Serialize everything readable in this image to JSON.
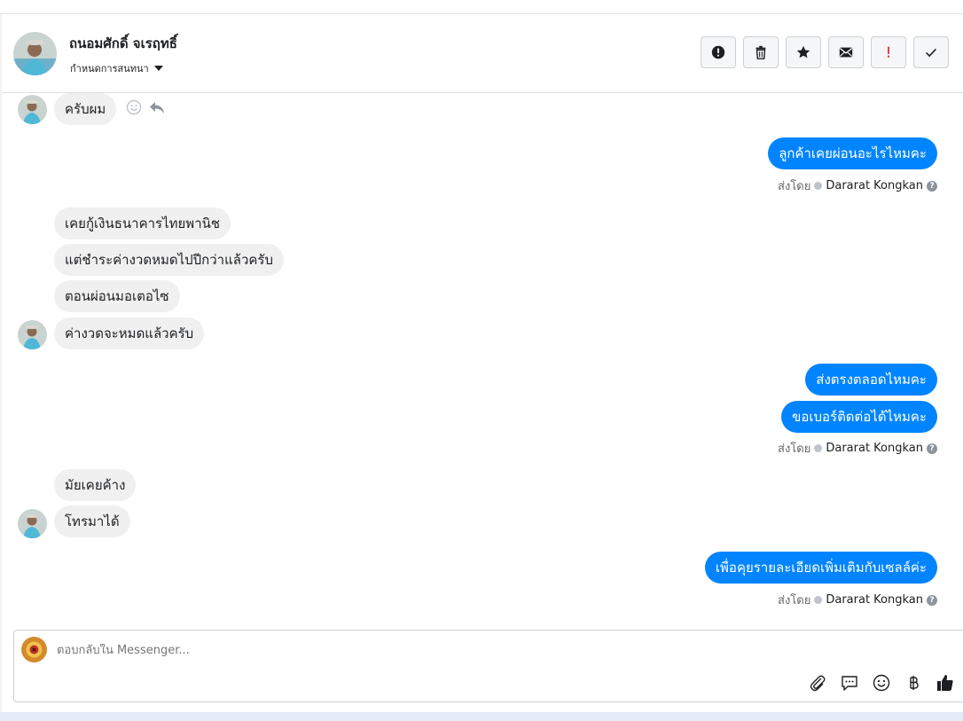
{
  "header": {
    "name": "ถนอมศักดิ์ จเรฤทธิ์",
    "subtitle": "กำหนดการสนทนา"
  },
  "actions": [
    {
      "name": "report-button",
      "icon": "exclamation-circle-icon"
    },
    {
      "name": "delete-button",
      "icon": "trash-icon"
    },
    {
      "name": "star-button",
      "icon": "star-icon"
    },
    {
      "name": "mark-unread-button",
      "icon": "envelope-icon"
    },
    {
      "name": "flag-button",
      "icon": "exclamation-icon"
    },
    {
      "name": "mark-done-button",
      "icon": "check-icon"
    }
  ],
  "messages": {
    "m1": "ครับผม",
    "m2": "ลูกค้าเคยผ่อนอะไรไหมคะ",
    "m3": "เคยกู้เงินธนาคารไทยพานิช",
    "m4": "แต่ชำระค่างวดหมดไปปีกว่าแล้วครับ",
    "m5": "ตอนผ่อนมอเตอไซ",
    "m6": "ค่างวดจะหมดแล้วครับ",
    "m7": "ส่งตรงตลอดไหมคะ",
    "m8": "ขอเบอร์ติดต่อได้ไหมคะ",
    "m9": "มัยเคยค้าง",
    "m10": "โทรมาได้",
    "m11": "เพื่อคุยรายละเอียดเพิ่มเติมกับเซลล์ค่ะ"
  },
  "sent_by": {
    "label": "ส่งโดย",
    "sender": "Dararat Kongkan"
  },
  "composer": {
    "placeholder": "ตอบกลับใน Messenger..."
  },
  "colors": {
    "outgoing_bubble": "#0084ff",
    "incoming_bubble": "#f0f0f0"
  }
}
